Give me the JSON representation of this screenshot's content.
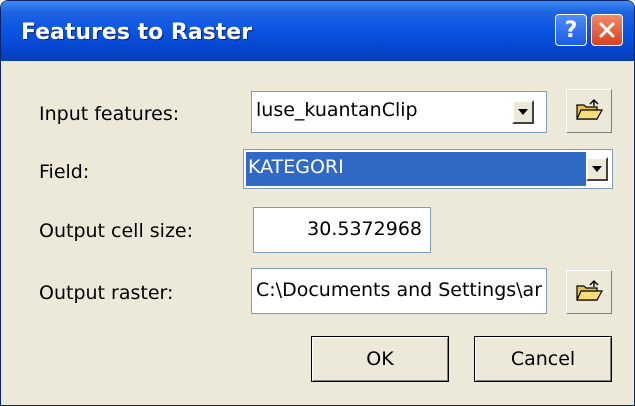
{
  "window": {
    "title": "Features to Raster",
    "help_label": "?"
  },
  "form": {
    "input_features": {
      "label": "Input features:",
      "value": "luse_kuantanClip"
    },
    "field": {
      "label": "Field:",
      "value": "KATEGORI"
    },
    "cell_size": {
      "label": "Output cell size:",
      "value": "30.5372968"
    },
    "output_raster": {
      "label": "Output raster:",
      "value": "C:\\Documents and Settings\\ar"
    }
  },
  "buttons": {
    "ok": "OK",
    "cancel": "Cancel"
  },
  "icons": [
    "help-icon",
    "close-icon",
    "chevron-down-icon",
    "open-folder-icon"
  ],
  "colors": {
    "titlebar": "#0a54e3",
    "selection": "#316ac5",
    "close": "#d8411f",
    "dialog_bg": "#ece9d8"
  }
}
